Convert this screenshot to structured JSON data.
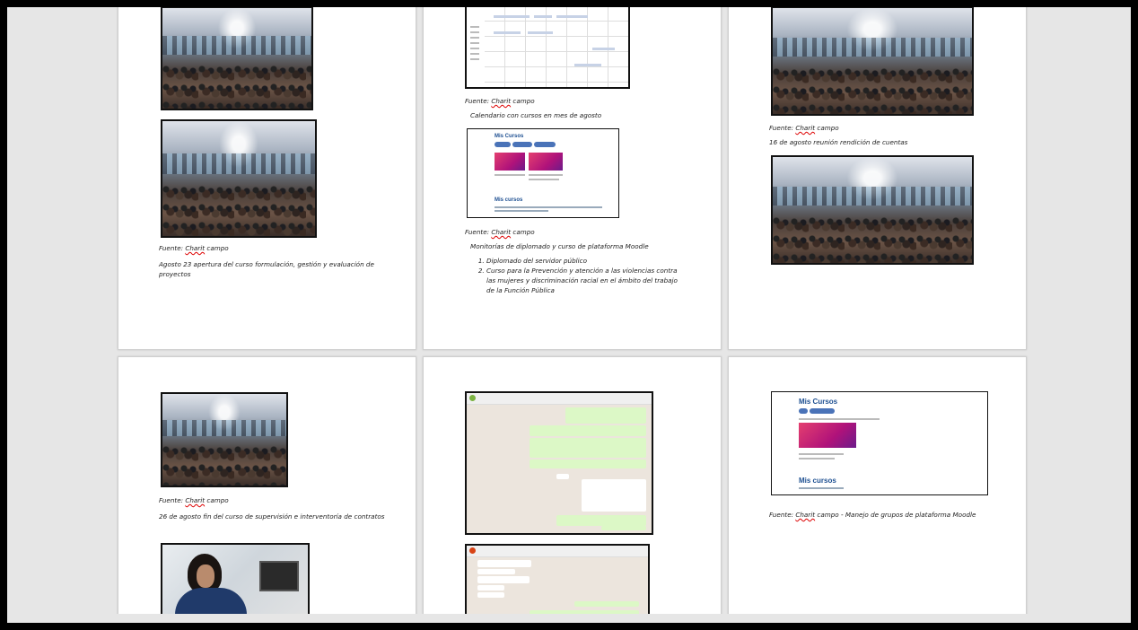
{
  "pages": {
    "p1": {
      "caption_source": "Fuente: ",
      "caption_source_name": "Charit",
      "caption_source_suffix": " campo",
      "caption_text": "Agosto 23 apertura del curso formulación, gestión y evaluación de proyectos"
    },
    "p2": {
      "cal_source": "Fuente: ",
      "cal_source_name": "Charit",
      "cal_source_suffix": " campo",
      "cal_caption": "Calendario con cursos en mes de agosto",
      "moodle_title": "Mis Cursos",
      "moodle_title2": "Mis cursos",
      "mon_source": "Fuente: ",
      "mon_source_name": "Charit",
      "mon_source_suffix": " campo",
      "mon_caption": "Monitorías de diplomado y curso de plataforma Moodle",
      "list": [
        "Diplomado del servidor público",
        "Curso para la Prevención y atención a las violencias contra las mujeres y discriminación racial en el ámbito del trabajo de la Función Pública"
      ]
    },
    "p3": {
      "caption_source": "Fuente: ",
      "caption_source_name": "Charit",
      "caption_source_suffix": " campo",
      "caption_text": "16 de agosto reunión rendición de cuentas"
    },
    "p4": {
      "caption_source": "Fuente: ",
      "caption_source_name": "Charit",
      "caption_source_suffix": " campo",
      "caption_text": "26 de agosto fin del curso de supervisión e interventoría de contratos"
    },
    "p6": {
      "moodle_title": "Mis Cursos",
      "moodle_title2": "Mis cursos",
      "caption_source": "Fuente: ",
      "caption_source_name": "Charit",
      "caption_source_suffix": " campo - Manejo de grupos de plataforma Moodle"
    }
  },
  "icons": {
    "photo": "photo-image",
    "screenshot": "screenshot-image"
  }
}
